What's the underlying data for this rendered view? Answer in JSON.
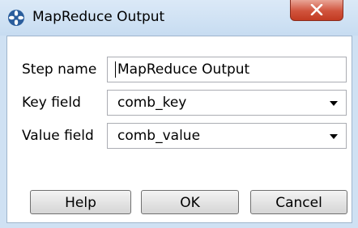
{
  "window": {
    "title": "MapReduce Output"
  },
  "form": {
    "step_name_label": "Step name",
    "step_name_value": "MapReduce Output",
    "key_field_label": "Key field",
    "key_field_value": "comb_key",
    "value_field_label": "Value field",
    "value_field_value": "comb_value"
  },
  "buttons": {
    "help": "Help",
    "ok": "OK",
    "cancel": "Cancel"
  },
  "icons": {
    "app": "kettle-spoon-icon",
    "close": "close-icon",
    "dropdown": "chevron-down-icon"
  },
  "colors": {
    "titlebar": "#c7dcf1",
    "close_button": "#c23b22",
    "app_icon": "#2a5d9c"
  }
}
